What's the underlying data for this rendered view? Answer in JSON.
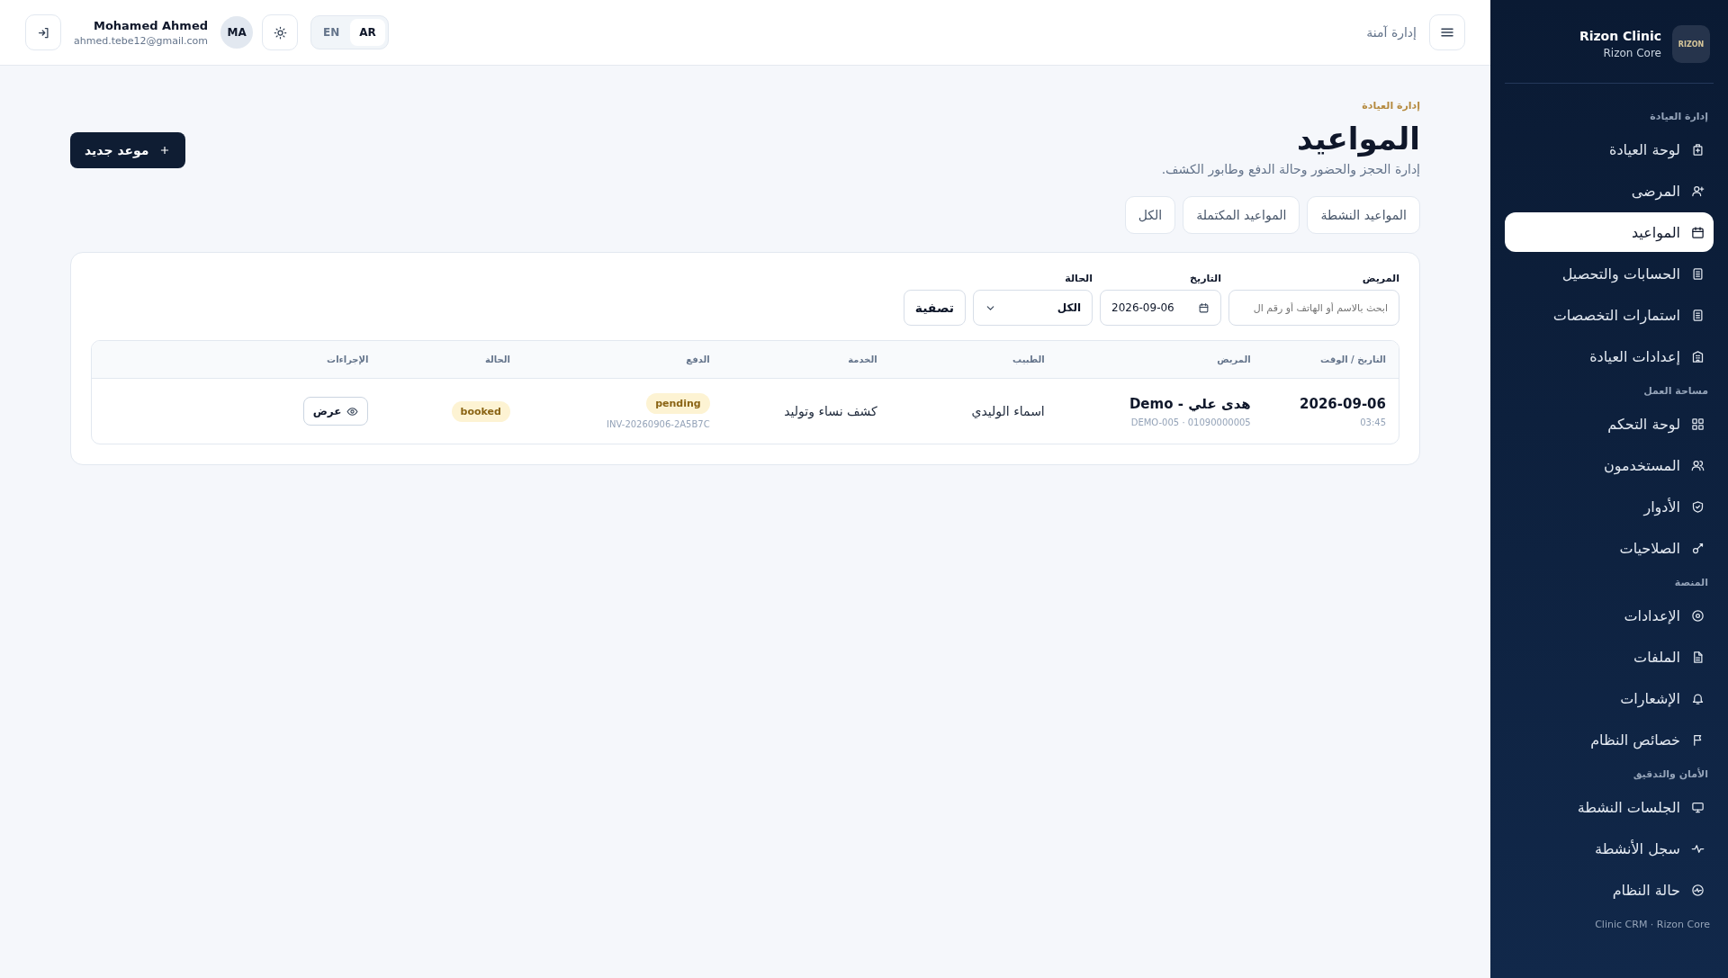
{
  "sidebar": {
    "brand": {
      "logo_text": "RIZON",
      "name": "Rizon Clinic",
      "subtitle": "Rizon Core"
    },
    "sections": [
      {
        "label": "إدارة العيادة",
        "items": [
          {
            "label": "لوحة العيادة",
            "selected": false
          },
          {
            "label": "المرضى",
            "selected": false
          },
          {
            "label": "المواعيد",
            "selected": true
          },
          {
            "label": "الحسابات والتحصيل",
            "selected": false
          },
          {
            "label": "استمارات التخصصات",
            "selected": false
          },
          {
            "label": "إعدادات العيادة",
            "selected": false
          }
        ]
      },
      {
        "label": "مساحة العمل",
        "items": [
          {
            "label": "لوحة التحكم",
            "selected": false
          },
          {
            "label": "المستخدمون",
            "selected": false
          },
          {
            "label": "الأدوار",
            "selected": false
          },
          {
            "label": "الصلاحيات",
            "selected": false
          }
        ]
      },
      {
        "label": "المنصة",
        "items": [
          {
            "label": "الإعدادات",
            "selected": false
          },
          {
            "label": "الملفات",
            "selected": false
          },
          {
            "label": "الإشعارات",
            "selected": false
          },
          {
            "label": "خصائص النظام",
            "selected": false
          }
        ]
      },
      {
        "label": "الأمان والتدقيق",
        "items": [
          {
            "label": "الجلسات النشطة",
            "selected": false
          },
          {
            "label": "سجل الأنشطة",
            "selected": false
          },
          {
            "label": "حالة النظام",
            "selected": false
          }
        ]
      }
    ],
    "footer": "Clinic CRM · Rizon Core"
  },
  "topbar": {
    "title": "إدارة آمنة",
    "languages": [
      {
        "label": "AR",
        "selected": true
      },
      {
        "label": "EN",
        "selected": false
      }
    ],
    "user": {
      "initials": "MA",
      "name": "Mohamed Ahmed",
      "email": "ahmed.tebe12@gmail.com"
    }
  },
  "page": {
    "eyebrow": "إدارة العيادة",
    "title": "المواعيد",
    "subtitle": "إدارة الحجز والحضور وحالة الدفع وطابور الكشف.",
    "new_button": "موعد جديد",
    "tabs": [
      {
        "label": "المواعيد النشطة",
        "selected": false
      },
      {
        "label": "المواعيد المكتملة",
        "selected": false
      },
      {
        "label": "الكل",
        "selected": false
      }
    ]
  },
  "filters": {
    "patient": {
      "label": "المريض",
      "placeholder": "ابحث بالاسم أو الهاتف أو رقم ال"
    },
    "date": {
      "label": "التاريخ",
      "value": "2026-09-06"
    },
    "status": {
      "label": "الحالة",
      "value": "الكل"
    },
    "button": "تصفية"
  },
  "table": {
    "columns": [
      "التاريخ / الوقت",
      "المريض",
      "الطبيب",
      "الخدمة",
      "الدفع",
      "الحالة",
      "الإجراءات"
    ],
    "rows": [
      {
        "date": "2026-09-06",
        "time": "03:45",
        "patient": "هدى علي - Demo",
        "patient_meta": "DEMO-005 · 01090000005",
        "doctor": "اسماء الوليدي",
        "service": "كشف نساء وتوليد",
        "payment": "pending",
        "invoice": "INV-20260906-2A5B7C",
        "status": "booked",
        "action": "عرض"
      }
    ]
  }
}
